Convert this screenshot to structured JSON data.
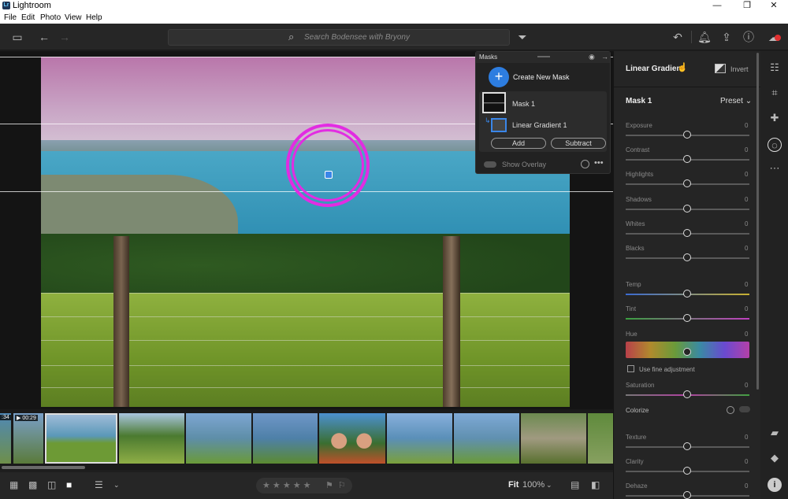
{
  "window": {
    "app_title": "Lightroom",
    "logo": "Lr"
  },
  "menu": [
    "File",
    "Edit",
    "Photo",
    "View",
    "Help"
  ],
  "toolbar": {
    "search_placeholder": "Search Bodensee with Bryony"
  },
  "masks_panel": {
    "title": "Masks",
    "create_label": "Create New Mask",
    "mask_name": "Mask 1",
    "component_name": "Linear Gradient 1",
    "add_label": "Add",
    "subtract_label": "Subtract",
    "show_overlay_label": "Show Overlay"
  },
  "right_panel": {
    "tool_title": "Linear Gradien",
    "invert_label": "Invert",
    "mask_heading": "Mask 1",
    "preset_label": "Preset",
    "sliders": [
      {
        "label": "Exposure",
        "value": "0"
      },
      {
        "label": "Contrast",
        "value": "0"
      },
      {
        "label": "Highlights",
        "value": "0"
      },
      {
        "label": "Shadows",
        "value": "0"
      },
      {
        "label": "Whites",
        "value": "0"
      },
      {
        "label": "Blacks",
        "value": "0"
      },
      {
        "label": "Temp",
        "value": "0"
      },
      {
        "label": "Tint",
        "value": "0"
      },
      {
        "label": "Hue",
        "value": "0"
      },
      {
        "label": "Saturation",
        "value": "0"
      },
      {
        "label": "Texture",
        "value": "0"
      },
      {
        "label": "Clarity",
        "value": "0"
      },
      {
        "label": "Dehaze",
        "value": "0"
      }
    ],
    "fine_adjust_label": "Use fine adjustment",
    "colorize_label": "Colorize"
  },
  "filmstrip": {
    "durations": [
      ":34",
      "▶ 00:29"
    ]
  },
  "bottom": {
    "stars": "★ ★ ★ ★ ★",
    "fit_label": "Fit",
    "zoom_label": "100%"
  },
  "colors": {
    "accent": "#2d7de0",
    "mask_ring": "#e22ce2",
    "overlay_tint": "#b976aa"
  }
}
